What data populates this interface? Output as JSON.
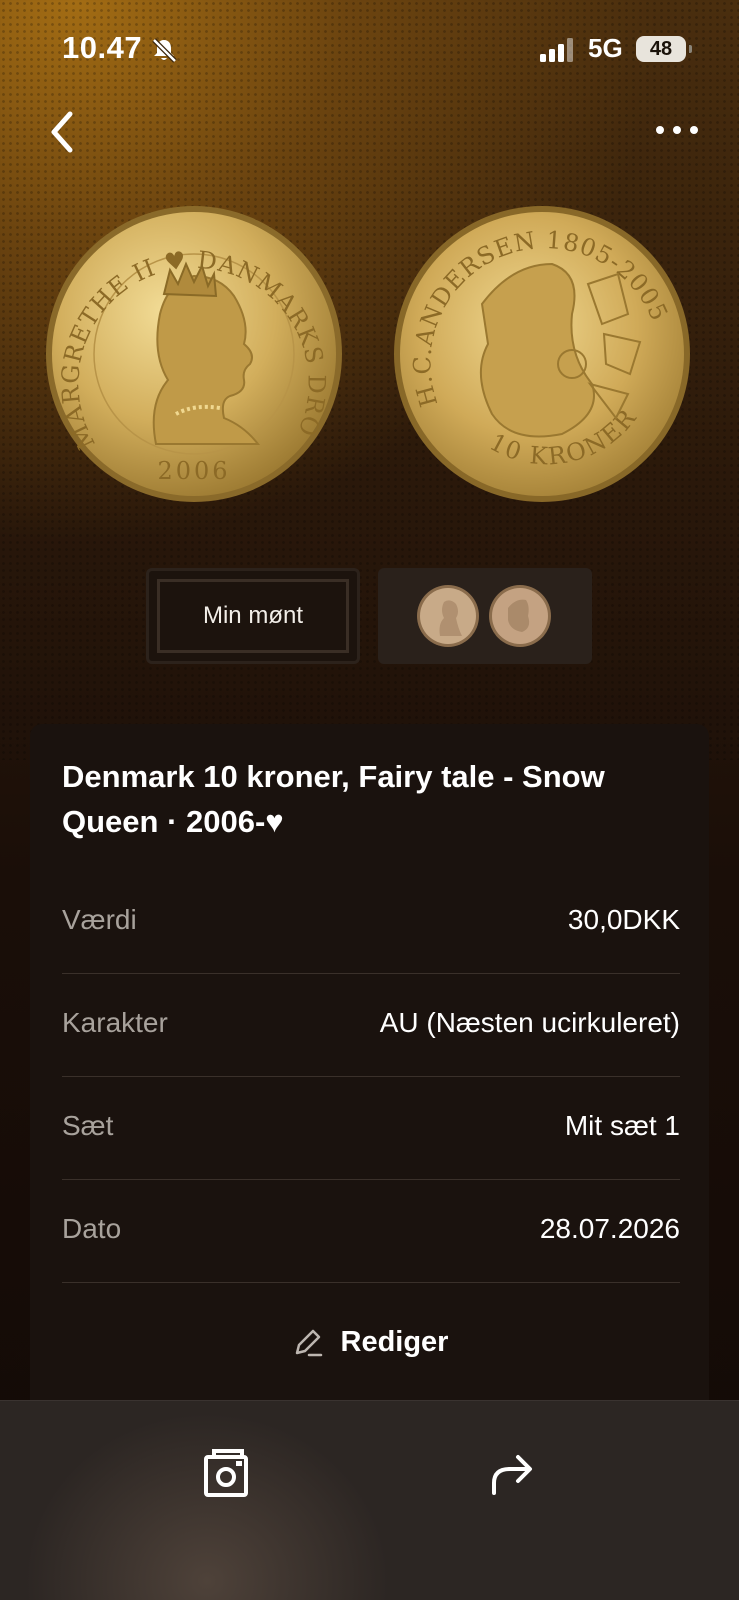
{
  "status_bar": {
    "time": "10.47",
    "network": "5G",
    "battery": "48"
  },
  "nav": {
    "back_icon": "chevron-left-icon",
    "more_icon": "ellipsis-icon"
  },
  "coin_images": {
    "obverse_legend": "MARGRETHE II ♥ DANMARKS DRONNING",
    "obverse_year": "2006",
    "reverse_legend": "H.C.ANDERSEN 1805-2005",
    "reverse_denomination": "10 KRONER"
  },
  "thumbnails": {
    "my_coin_label": "Min mønt"
  },
  "coin": {
    "title": "Denmark 10 kroner, Fairy tale - Snow Queen · 2006-♥",
    "details": [
      {
        "label": "Værdi",
        "value": "30,0DKK"
      },
      {
        "label": "Karakter",
        "value": "AU (Næsten ucirkuleret)"
      },
      {
        "label": "Sæt",
        "value": "Mit sæt 1"
      },
      {
        "label": "Dato",
        "value": "28.07.2026"
      }
    ],
    "edit_label": "Rediger"
  },
  "bottom_bar": {
    "photo_icon": "photo-frame-icon",
    "share_icon": "share-arrow-icon"
  },
  "colors": {
    "gold": "#c9a24a",
    "card_bg": "#1a120e",
    "muted_text": "#a8a29c"
  }
}
